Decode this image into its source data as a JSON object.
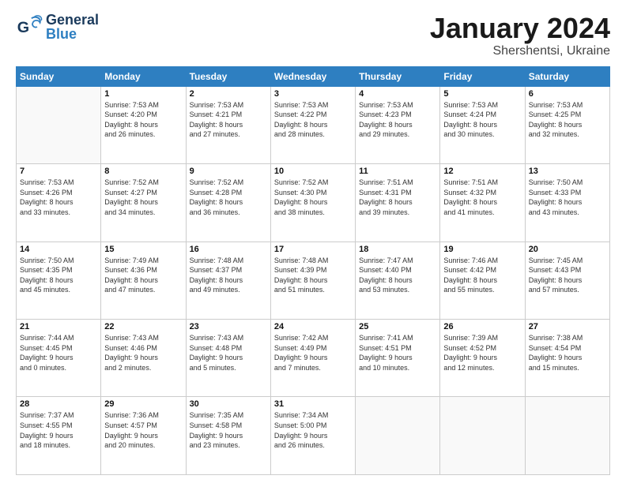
{
  "header": {
    "logo_general": "General",
    "logo_blue": "Blue",
    "month_title": "January 2024",
    "subtitle": "Shershentsi, Ukraine"
  },
  "days_of_week": [
    "Sunday",
    "Monday",
    "Tuesday",
    "Wednesday",
    "Thursday",
    "Friday",
    "Saturday"
  ],
  "weeks": [
    [
      {
        "num": "",
        "info": ""
      },
      {
        "num": "1",
        "info": "Sunrise: 7:53 AM\nSunset: 4:20 PM\nDaylight: 8 hours\nand 26 minutes."
      },
      {
        "num": "2",
        "info": "Sunrise: 7:53 AM\nSunset: 4:21 PM\nDaylight: 8 hours\nand 27 minutes."
      },
      {
        "num": "3",
        "info": "Sunrise: 7:53 AM\nSunset: 4:22 PM\nDaylight: 8 hours\nand 28 minutes."
      },
      {
        "num": "4",
        "info": "Sunrise: 7:53 AM\nSunset: 4:23 PM\nDaylight: 8 hours\nand 29 minutes."
      },
      {
        "num": "5",
        "info": "Sunrise: 7:53 AM\nSunset: 4:24 PM\nDaylight: 8 hours\nand 30 minutes."
      },
      {
        "num": "6",
        "info": "Sunrise: 7:53 AM\nSunset: 4:25 PM\nDaylight: 8 hours\nand 32 minutes."
      }
    ],
    [
      {
        "num": "7",
        "info": "Sunrise: 7:53 AM\nSunset: 4:26 PM\nDaylight: 8 hours\nand 33 minutes."
      },
      {
        "num": "8",
        "info": "Sunrise: 7:52 AM\nSunset: 4:27 PM\nDaylight: 8 hours\nand 34 minutes."
      },
      {
        "num": "9",
        "info": "Sunrise: 7:52 AM\nSunset: 4:28 PM\nDaylight: 8 hours\nand 36 minutes."
      },
      {
        "num": "10",
        "info": "Sunrise: 7:52 AM\nSunset: 4:30 PM\nDaylight: 8 hours\nand 38 minutes."
      },
      {
        "num": "11",
        "info": "Sunrise: 7:51 AM\nSunset: 4:31 PM\nDaylight: 8 hours\nand 39 minutes."
      },
      {
        "num": "12",
        "info": "Sunrise: 7:51 AM\nSunset: 4:32 PM\nDaylight: 8 hours\nand 41 minutes."
      },
      {
        "num": "13",
        "info": "Sunrise: 7:50 AM\nSunset: 4:33 PM\nDaylight: 8 hours\nand 43 minutes."
      }
    ],
    [
      {
        "num": "14",
        "info": "Sunrise: 7:50 AM\nSunset: 4:35 PM\nDaylight: 8 hours\nand 45 minutes."
      },
      {
        "num": "15",
        "info": "Sunrise: 7:49 AM\nSunset: 4:36 PM\nDaylight: 8 hours\nand 47 minutes."
      },
      {
        "num": "16",
        "info": "Sunrise: 7:48 AM\nSunset: 4:37 PM\nDaylight: 8 hours\nand 49 minutes."
      },
      {
        "num": "17",
        "info": "Sunrise: 7:48 AM\nSunset: 4:39 PM\nDaylight: 8 hours\nand 51 minutes."
      },
      {
        "num": "18",
        "info": "Sunrise: 7:47 AM\nSunset: 4:40 PM\nDaylight: 8 hours\nand 53 minutes."
      },
      {
        "num": "19",
        "info": "Sunrise: 7:46 AM\nSunset: 4:42 PM\nDaylight: 8 hours\nand 55 minutes."
      },
      {
        "num": "20",
        "info": "Sunrise: 7:45 AM\nSunset: 4:43 PM\nDaylight: 8 hours\nand 57 minutes."
      }
    ],
    [
      {
        "num": "21",
        "info": "Sunrise: 7:44 AM\nSunset: 4:45 PM\nDaylight: 9 hours\nand 0 minutes."
      },
      {
        "num": "22",
        "info": "Sunrise: 7:43 AM\nSunset: 4:46 PM\nDaylight: 9 hours\nand 2 minutes."
      },
      {
        "num": "23",
        "info": "Sunrise: 7:43 AM\nSunset: 4:48 PM\nDaylight: 9 hours\nand 5 minutes."
      },
      {
        "num": "24",
        "info": "Sunrise: 7:42 AM\nSunset: 4:49 PM\nDaylight: 9 hours\nand 7 minutes."
      },
      {
        "num": "25",
        "info": "Sunrise: 7:41 AM\nSunset: 4:51 PM\nDaylight: 9 hours\nand 10 minutes."
      },
      {
        "num": "26",
        "info": "Sunrise: 7:39 AM\nSunset: 4:52 PM\nDaylight: 9 hours\nand 12 minutes."
      },
      {
        "num": "27",
        "info": "Sunrise: 7:38 AM\nSunset: 4:54 PM\nDaylight: 9 hours\nand 15 minutes."
      }
    ],
    [
      {
        "num": "28",
        "info": "Sunrise: 7:37 AM\nSunset: 4:55 PM\nDaylight: 9 hours\nand 18 minutes."
      },
      {
        "num": "29",
        "info": "Sunrise: 7:36 AM\nSunset: 4:57 PM\nDaylight: 9 hours\nand 20 minutes."
      },
      {
        "num": "30",
        "info": "Sunrise: 7:35 AM\nSunset: 4:58 PM\nDaylight: 9 hours\nand 23 minutes."
      },
      {
        "num": "31",
        "info": "Sunrise: 7:34 AM\nSunset: 5:00 PM\nDaylight: 9 hours\nand 26 minutes."
      },
      {
        "num": "",
        "info": ""
      },
      {
        "num": "",
        "info": ""
      },
      {
        "num": "",
        "info": ""
      }
    ]
  ]
}
